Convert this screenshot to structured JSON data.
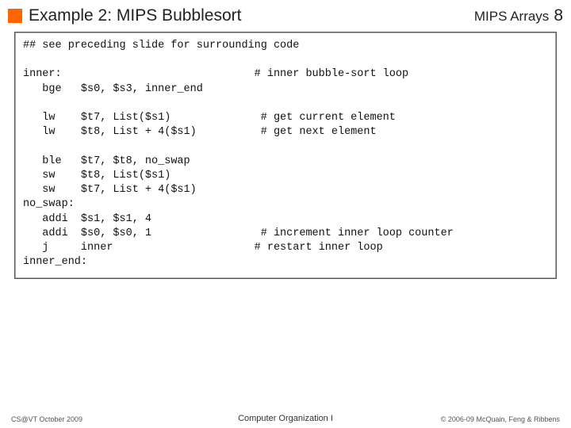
{
  "header": {
    "title": "Example 2: MIPS Bubblesort",
    "right_label": "MIPS Arrays",
    "page_number": "8"
  },
  "code": "## see preceding slide for surrounding code\n\ninner:                              # inner bubble-sort loop\n   bge   $s0, $s3, inner_end\n\n   lw    $t7, List($s1)              # get current element\n   lw    $t8, List + 4($s1)          # get next element\n\n   ble   $t7, $t8, no_swap\n   sw    $t8, List($s1)\n   sw    $t7, List + 4($s1)\nno_swap:\n   addi  $s1, $s1, 4\n   addi  $s0, $s0, 1                 # increment inner loop counter\n   j     inner                      # restart inner loop\ninner_end:",
  "footer": {
    "left": "CS@VT October 2009",
    "center": "Computer Organization I",
    "right": "© 2006-09  McQuain, Feng & Ribbens"
  }
}
